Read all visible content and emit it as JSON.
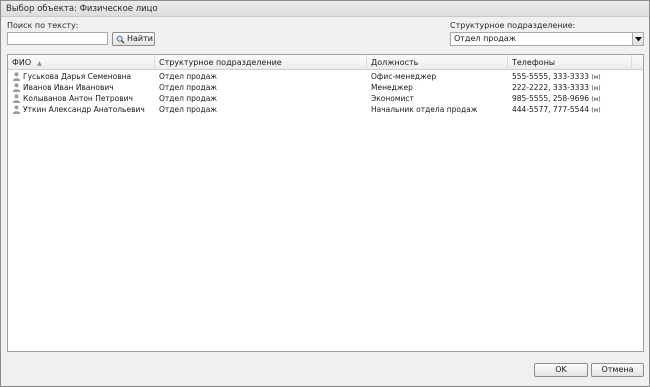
{
  "window": {
    "title": "Выбор объекта: Физическое лицо"
  },
  "search": {
    "label": "Поиск по тексту:",
    "value": "",
    "placeholder": "",
    "button_label": "Найти"
  },
  "department": {
    "label": "Структурное подразделение:",
    "selected": "Отдел продаж"
  },
  "grid": {
    "columns": [
      "ФИО",
      "Структурное подразделение",
      "Должность",
      "Телефоны"
    ],
    "sort_indicator": "▲",
    "rows": [
      {
        "name": "Гуськова Дарья Семеновна",
        "department": "Отдел продаж",
        "position": "Офис-менеджер",
        "phones": "555-5555,  333-3333",
        "phone_suffix": "(м)"
      },
      {
        "name": "Иванов Иван Иванович",
        "department": "Отдел продаж",
        "position": "Менеджер",
        "phones": "222-2222,  333-3333",
        "phone_suffix": "(м)"
      },
      {
        "name": "Колыванов Антон Петрович",
        "department": "Отдел продаж",
        "position": "Экономист",
        "phones": "985-5555,  258-9696",
        "phone_suffix": "(м)"
      },
      {
        "name": "Уткин Александр Анатольевич",
        "department": "Отдел продаж",
        "position": "Начальник отдела продаж",
        "phones": "444-5577,  777-5544",
        "phone_suffix": "(м)"
      }
    ]
  },
  "buttons": {
    "ok": "OK",
    "cancel": "Отмена"
  },
  "icons": {
    "person": "person-icon",
    "find": "search-icon",
    "dropdown": "chevron-down-icon"
  }
}
